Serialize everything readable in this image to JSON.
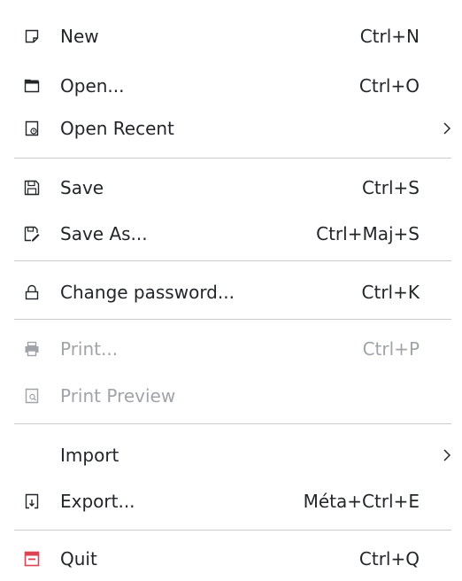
{
  "menu": {
    "items": {
      "new": {
        "label": "New",
        "shortcut": "Ctrl+N",
        "icon": "new-document-icon"
      },
      "open": {
        "label": "Open...",
        "shortcut": "Ctrl+O",
        "icon": "folder-open-icon"
      },
      "open_recent": {
        "label": "Open Recent",
        "icon": "recent-document-icon"
      },
      "save": {
        "label": "Save",
        "shortcut": "Ctrl+S",
        "icon": "save-icon"
      },
      "save_as": {
        "label": "Save As...",
        "shortcut": "Ctrl+Maj+S",
        "icon": "save-as-icon"
      },
      "change_password": {
        "label": "Change password...",
        "shortcut": "Ctrl+K",
        "icon": "lock-icon"
      },
      "print": {
        "label": "Print...",
        "shortcut": "Ctrl+P",
        "icon": "printer-icon",
        "disabled": true
      },
      "print_preview": {
        "label": "Print Preview",
        "icon": "print-preview-icon",
        "disabled": true
      },
      "import": {
        "label": "Import"
      },
      "export": {
        "label": "Export...",
        "shortcut": "Méta+Ctrl+E",
        "icon": "export-icon"
      },
      "quit": {
        "label": "Quit",
        "shortcut": "Ctrl+Q",
        "icon": "quit-icon"
      }
    }
  },
  "colors": {
    "text": "#232629",
    "disabled_text": "#a0a4a8",
    "separator": "#c9cbcd",
    "quit_icon": "#da4453"
  }
}
